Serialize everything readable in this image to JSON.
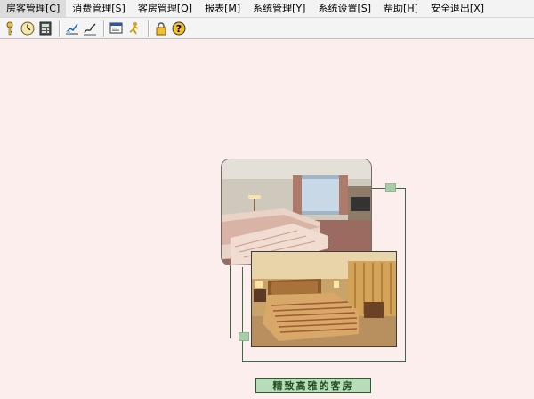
{
  "menu": {
    "items": [
      {
        "label": "房客管理[C]"
      },
      {
        "label": "消费管理[S]"
      },
      {
        "label": "客房管理[Q]"
      },
      {
        "label": "报表[M]"
      },
      {
        "label": "系统管理[Y]"
      },
      {
        "label": "系统设置[S]"
      },
      {
        "label": "帮助[H]"
      },
      {
        "label": "安全退出[X]"
      }
    ]
  },
  "toolbar": {
    "icons": [
      "key-icon",
      "clock-icon",
      "calculator-icon",
      "chart-edit-icon",
      "sign-icon",
      "window-report-icon",
      "person-icon",
      "lock-icon",
      "help-icon"
    ]
  },
  "banner": {
    "caption": "精致高雅的客房"
  },
  "colors": {
    "background": "#fdeeee",
    "frame": "#3b6b45",
    "caption_bg": "#b8dbb8"
  }
}
